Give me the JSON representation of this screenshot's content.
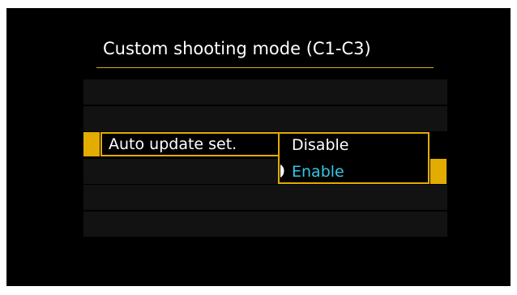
{
  "menu": {
    "title": "Custom shooting mode (C1-C3)",
    "setting_label": "Auto update set.",
    "options": [
      {
        "label": "Disable",
        "selected": false
      },
      {
        "label": "Enable",
        "selected": true
      }
    ]
  },
  "colors": {
    "accent": "#e2ac00",
    "selected_text": "#33c7e6",
    "background": "#000000",
    "row_fill": "#121212"
  },
  "icons": {
    "selection_cursor": "selection-cursor-icon"
  }
}
